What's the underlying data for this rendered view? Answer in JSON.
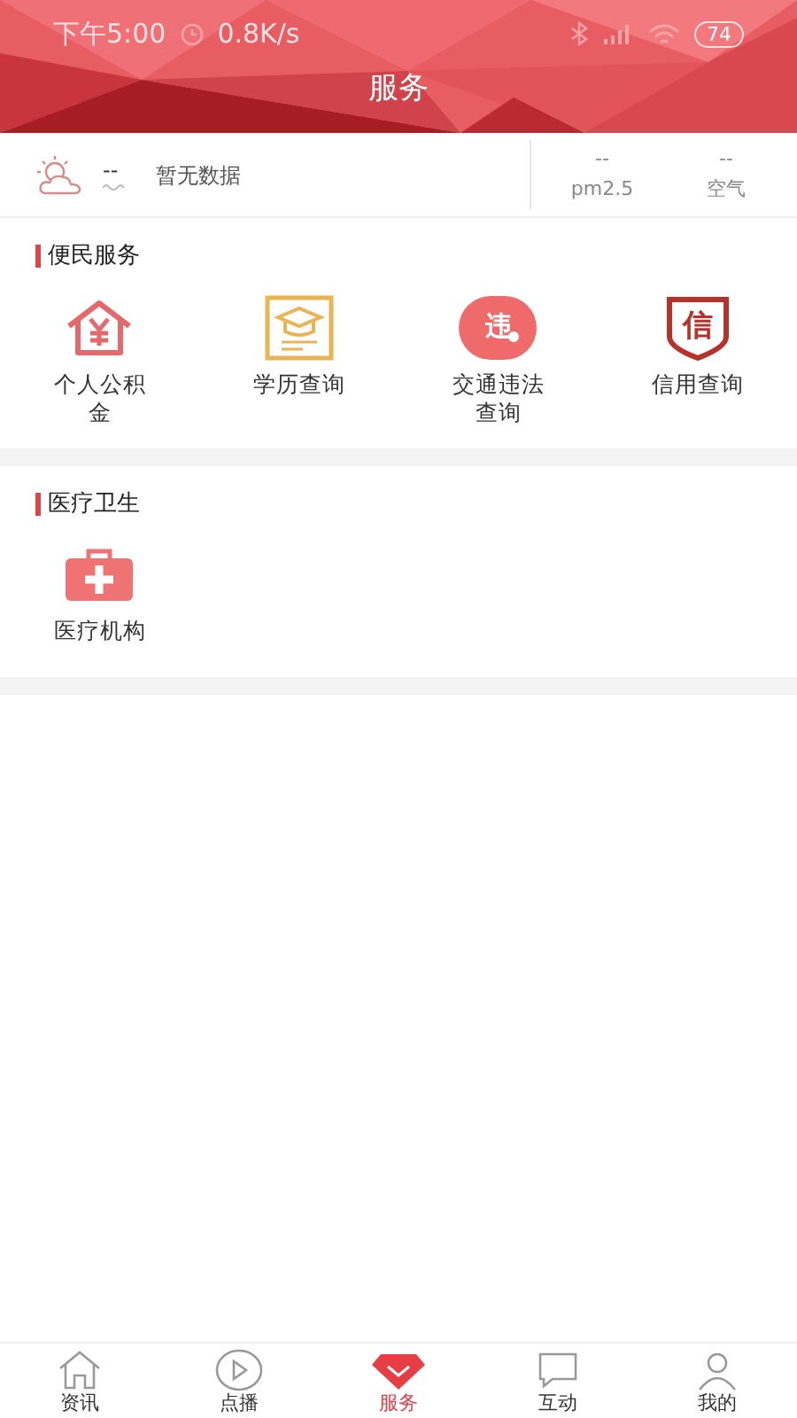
{
  "status_bar": {
    "time": "下午5:00",
    "speed": "0.8K/s",
    "battery": "74"
  },
  "header": {
    "title": "服务"
  },
  "weather": {
    "temperature": "--",
    "status": "暂无数据",
    "pm25": {
      "value": "--",
      "label": "pm2.5"
    },
    "air": {
      "value": "--",
      "label": "空气"
    }
  },
  "sections": [
    {
      "title": "便民服务",
      "items": [
        {
          "kind": "house",
          "label": "个人公积金"
        },
        {
          "kind": "cap",
          "label": "学历查询"
        },
        {
          "kind": "circle",
          "glyph": "违",
          "label": "交通违法查询"
        },
        {
          "kind": "shield",
          "glyph": "信",
          "label": "信用查询"
        }
      ]
    },
    {
      "title": "医疗卫生",
      "items": [
        {
          "kind": "kit",
          "label": "医疗机构"
        }
      ]
    }
  ],
  "tabs": [
    {
      "kind": "home",
      "label": "资讯",
      "selected": false
    },
    {
      "kind": "play",
      "label": "点播",
      "selected": false
    },
    {
      "kind": "gem",
      "label": "服务",
      "selected": true
    },
    {
      "kind": "chat",
      "label": "互动",
      "selected": false
    },
    {
      "kind": "user",
      "label": "我的",
      "selected": false
    }
  ]
}
